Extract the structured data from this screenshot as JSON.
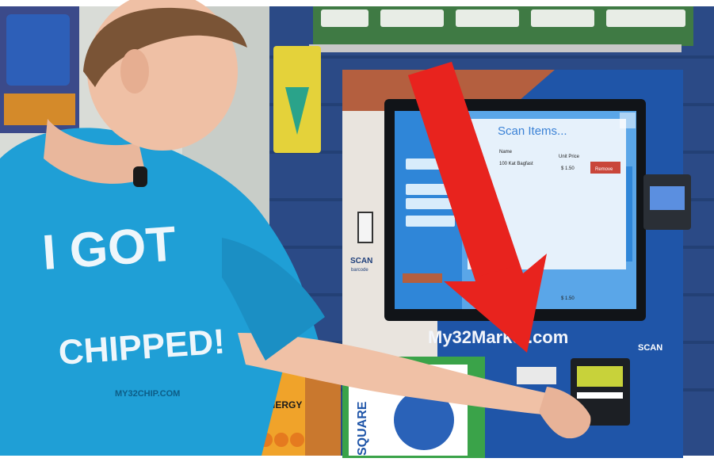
{
  "photo": {
    "kiosk": {
      "screen": {
        "header": "Scan Items...",
        "col_name": "Name",
        "col_price": "Unit Price",
        "item_name": "100 Kat Bagfast",
        "item_price": "$ 1.50",
        "remove_label": "Remove",
        "total": "$ 1.50"
      },
      "brand_url": "My32Market.com",
      "scan_label": "SCAN",
      "scan_sub_label": "barcode",
      "scan_label_right": "SCAN",
      "card_reader_screen": "SQUARE",
      "side_sign": "SQUARE"
    },
    "shirt": {
      "line1": "I GOT",
      "line2": "CHIPPED!",
      "small": "MY32CHIP.COM"
    },
    "energy_box": "5-hour ENERGY",
    "colors": {
      "shirt": "#1f9fd6",
      "kiosk_blue": "#1f55a8",
      "arrow": "#e8231e",
      "screen_bg": "#5aa6e8"
    }
  }
}
